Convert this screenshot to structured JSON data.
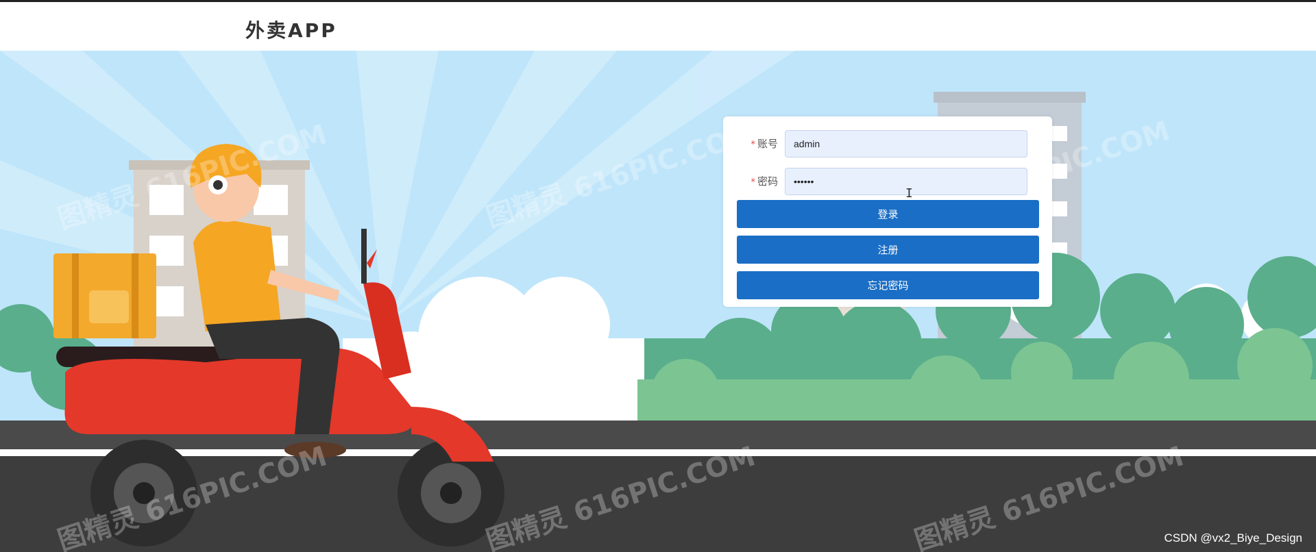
{
  "header": {
    "title": "外卖APP"
  },
  "login_form": {
    "account": {
      "label": "账号",
      "required_mark": "*",
      "value": "admin"
    },
    "password": {
      "label": "密码",
      "required_mark": "*",
      "value": "••••••"
    },
    "login_button": "登录",
    "register_button": "注册",
    "forgot_button": "忘记密码"
  },
  "watermark": {
    "text": "图精灵 616PIC.COM"
  },
  "footer": {
    "credit": "CSDN @vx2_Biye_Design"
  },
  "colors": {
    "primary": "#1a6ec5",
    "sky": "#bfe5fa",
    "road": "#4a4a4a",
    "scooter": "#e4382a"
  },
  "icons": {
    "text_cursor": "i-beam-cursor-icon"
  }
}
